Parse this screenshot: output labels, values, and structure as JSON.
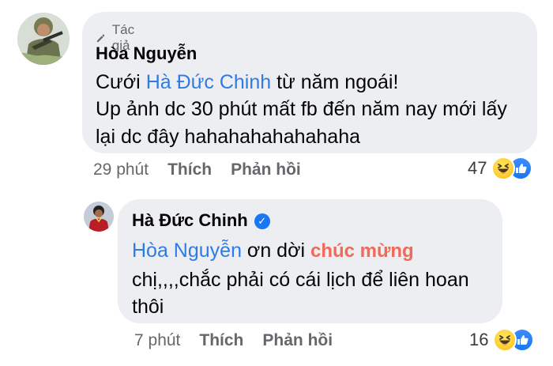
{
  "comments": [
    {
      "author_badge": "Tác giả",
      "author_name": "Hòa Nguyễn",
      "text": {
        "line1_prefix": "Cưới ",
        "line1_tag": "Hà Đức Chinh",
        "line1_suffix": " từ năm ngoái!",
        "line2": "Up ảnh dc 30 phút mất fb đến năm nay mới lấy",
        "line3": "lại dc đây hahahahahahahaha"
      },
      "time": "29 phút",
      "like_action": "Thích",
      "reply_action": "Phản hồi",
      "reaction_count": "47",
      "reaction_icons": [
        "haha-icon",
        "like-icon"
      ]
    },
    {
      "author_name": "Hà Đức Chinh",
      "verified_icon": "verified-badge-icon",
      "text": {
        "tag": "Hòa Nguyễn",
        "after_tag": " ơn dời ",
        "highlight": "chúc mừng",
        "line2": "chị,,,,chắc phải có cái lịch để liên hoan",
        "line3": "thôi"
      },
      "time": "7 phút",
      "like_action": "Thích",
      "reply_action": "Phản hồi",
      "reaction_count": "16",
      "reaction_icons": [
        "haha-icon",
        "like-icon"
      ]
    }
  ],
  "colors": {
    "tag_blue": "#2f7be5",
    "highlight_red": "#f06a5a",
    "bubble_bg": "#eceef1",
    "meta_gray": "#65676b",
    "like_blue": "#1877f2",
    "haha_yellow": "#ffd23c"
  }
}
